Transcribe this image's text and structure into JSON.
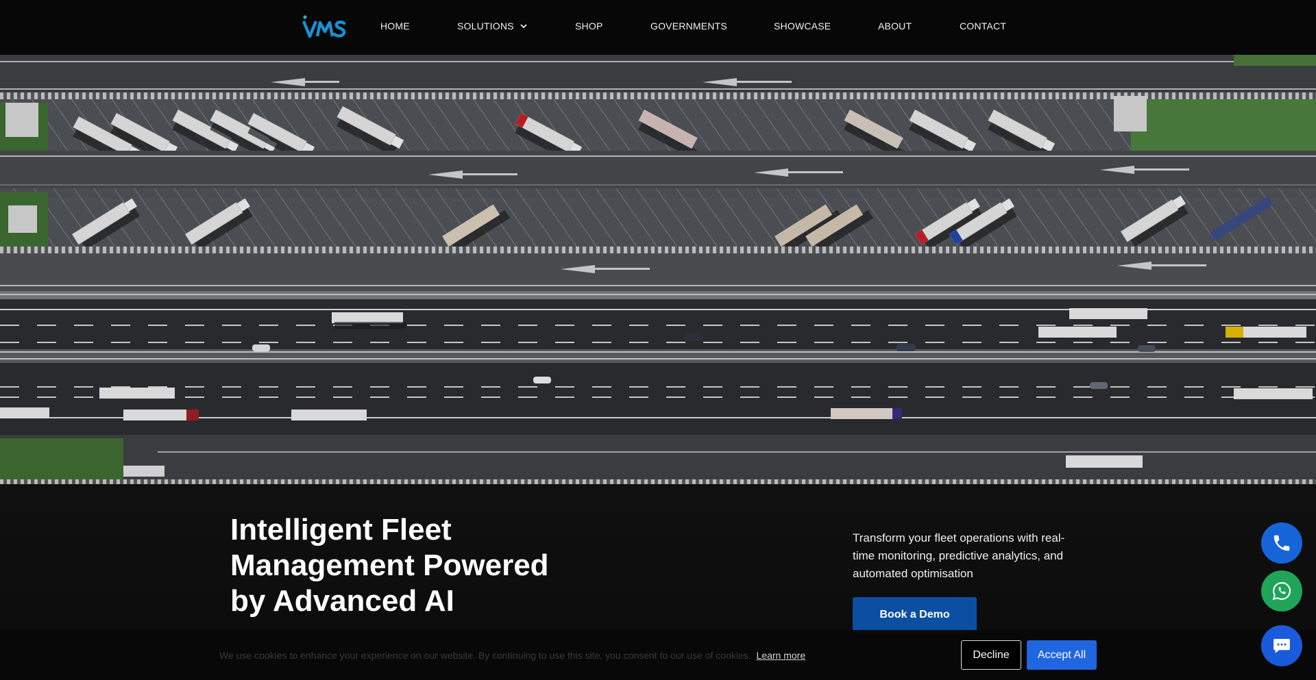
{
  "brand": {
    "logo_text": "VMS",
    "logo_color": "#1b8fd0"
  },
  "nav": {
    "items": [
      {
        "label": "HOME"
      },
      {
        "label": "SOLUTIONS",
        "has_dropdown": true
      },
      {
        "label": "SHOP"
      },
      {
        "label": "GOVERNMENTS"
      },
      {
        "label": "SHOWCASE"
      },
      {
        "label": "ABOUT"
      },
      {
        "label": "CONTACT"
      }
    ]
  },
  "hero": {
    "headline": "Intelligent Fleet Management Powered by Advanced AI",
    "tagline": "Transform your fleet operations with real-time monitoring, predictive analytics, and automated optimisation",
    "cta_label": "Book a Demo"
  },
  "fabs": {
    "phone_icon": "phone-icon",
    "whatsapp_icon": "whatsapp-icon",
    "chat_icon": "chat-icon"
  },
  "cookie": {
    "text": "We use cookies to enhance your experience on our website. By continuing to use this site, you consent to our use of cookies.",
    "link": "Learn more",
    "decline": "Decline",
    "accept": "Accept All"
  },
  "colors": {
    "accent_blue": "#0b4fa2",
    "accept_blue": "#1f66e0",
    "whatsapp_green": "#1fa45a",
    "phone_blue": "#1565d8"
  }
}
